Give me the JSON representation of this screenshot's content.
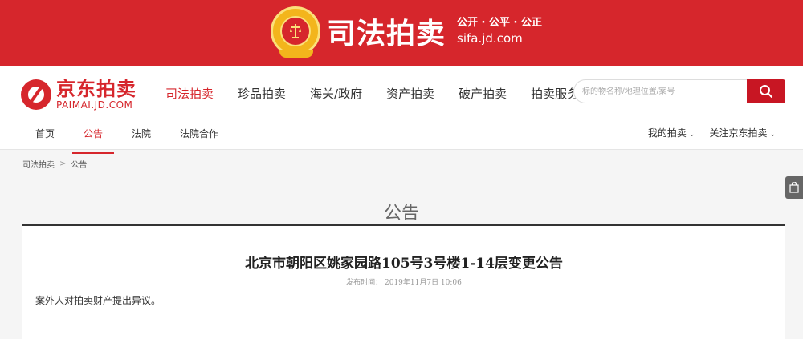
{
  "banner": {
    "title": "司法拍卖",
    "slogan": "公开 · 公平 · 公正",
    "domain": "sifa.jd.com"
  },
  "logo": {
    "cn": "京东拍卖",
    "en": "PAIMAI.JD.COM"
  },
  "main_nav": [
    "司法拍卖",
    "珍品拍卖",
    "海关/政府",
    "资产拍卖",
    "破产拍卖",
    "拍卖服务"
  ],
  "search": {
    "placeholder": "标的物名称/地理位置/案号"
  },
  "sub_nav": [
    "首页",
    "公告",
    "法院",
    "法院合作"
  ],
  "right_links": [
    "我的拍卖",
    "关注京东拍卖"
  ],
  "breadcrumb": [
    "司法拍卖",
    "公告"
  ],
  "section_title": "公告",
  "notice": {
    "title": "北京市朝阳区姚家园路105号3号楼1-14层变更公告",
    "meta": "发布时间： 2019年11月7日 10:06",
    "body": "案外人对拍卖财产提出异议。"
  },
  "colors": {
    "brand_red": "#d6262c",
    "search_red": "#c81623"
  }
}
